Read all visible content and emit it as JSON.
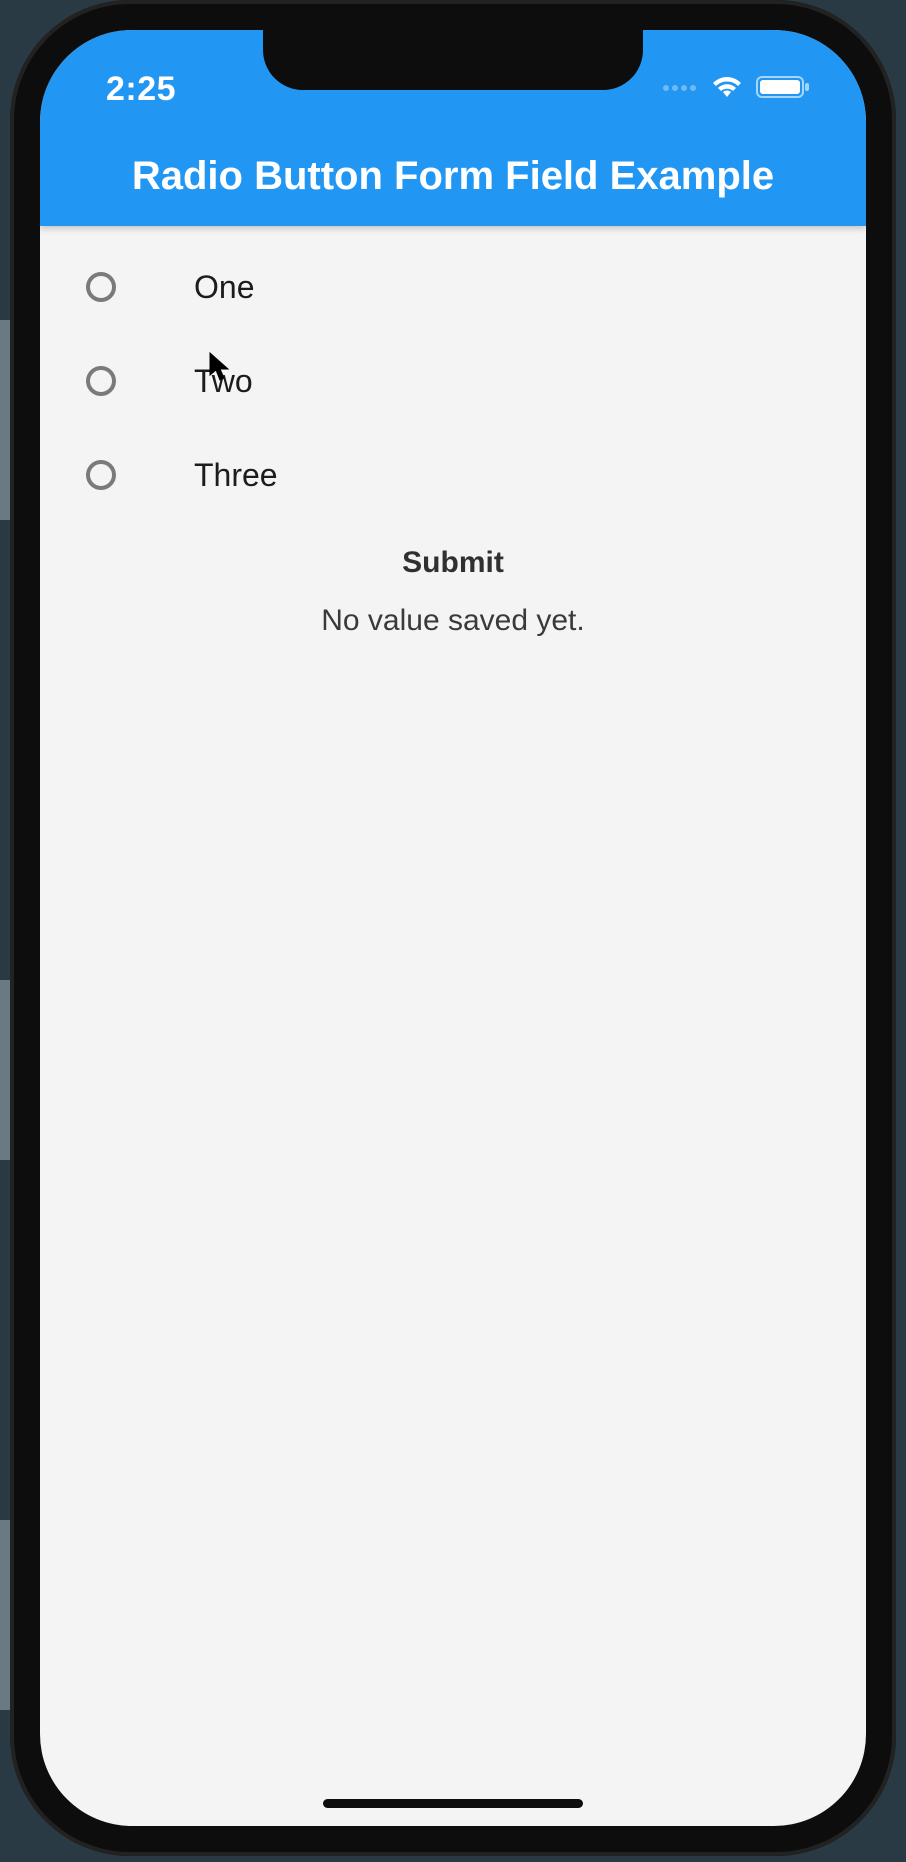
{
  "statusbar": {
    "time": "2:25"
  },
  "appbar": {
    "title": "Radio Button Form Field Example"
  },
  "form": {
    "options": [
      {
        "label": "One"
      },
      {
        "label": "Two"
      },
      {
        "label": "Three"
      }
    ],
    "submit_label": "Submit",
    "status_text": "No value saved yet."
  }
}
